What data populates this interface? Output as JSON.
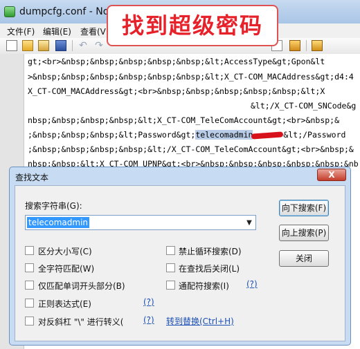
{
  "window": {
    "title": "dumpcfg.conf - Notep"
  },
  "banner": {
    "text": "找到超级密码"
  },
  "menu": [
    "文件(F)",
    "编辑(E)",
    "查看(V"
  ],
  "editor": {
    "lines": [
      "gt;<br>&nbsp;&nbsp;&nbsp;&nbsp;&nbsp;&lt;AccessType&gt;Gpon&lt",
      ">&nbsp;&nbsp;&nbsp;&nbsp;&nbsp;&nbsp;&lt;X_CT-COM_MACAddress&gt;d4:4",
      "X_CT-COM_MACAddress&gt;<br>&nbsp;&nbsp;&nbsp;&nbsp;&nbsp;&lt;X",
      "&lt;/X_CT-COM_SNCode&g",
      "nbsp;&nbsp;&nbsp;&nbsp;&lt;X_CT-COM_TeleComAccount&gt;<br>&nbsp;&",
      ";&nbsp;&nbsp;&nbsp;&lt;Password&gt;",
      "&lt;/Password",
      ";&nbsp;&nbsp;&nbsp;&nbsp;&lt;/X_CT-COM_TeleComAccount&gt;<br>&nbsp;&",
      "nbsp;&nbsp;&lt;X_CT-COM_UPNP&gt;<br>&nbsp;&nbsp;&nbsp;&nbsp;&nbsp;&nb"
    ],
    "highlight": "telecomadmin"
  },
  "dialog": {
    "title": "查找文本",
    "close_label": "X",
    "search_label": "搜索字符串(G):",
    "search_value": "telecomadmin",
    "buttons": {
      "find_down": "向下搜索(F)",
      "find_up": "向上搜索(P)",
      "close": "关闭"
    },
    "options": {
      "match_case": "区分大小写(C)",
      "whole_word": "全字符匹配(W)",
      "word_start": "仅匹配单词开头部分(B)",
      "regex": "正则表达式(E)",
      "escape": "对反斜杠 \"\\\" 进行转义(",
      "no_wrap": "禁止循环搜索(D)",
      "close_after": "在查找后关闭(L)",
      "wildcard": "通配符搜索(I)"
    },
    "help_mark": "(?)",
    "replace_link": "转到替换(Ctrl+H)"
  }
}
